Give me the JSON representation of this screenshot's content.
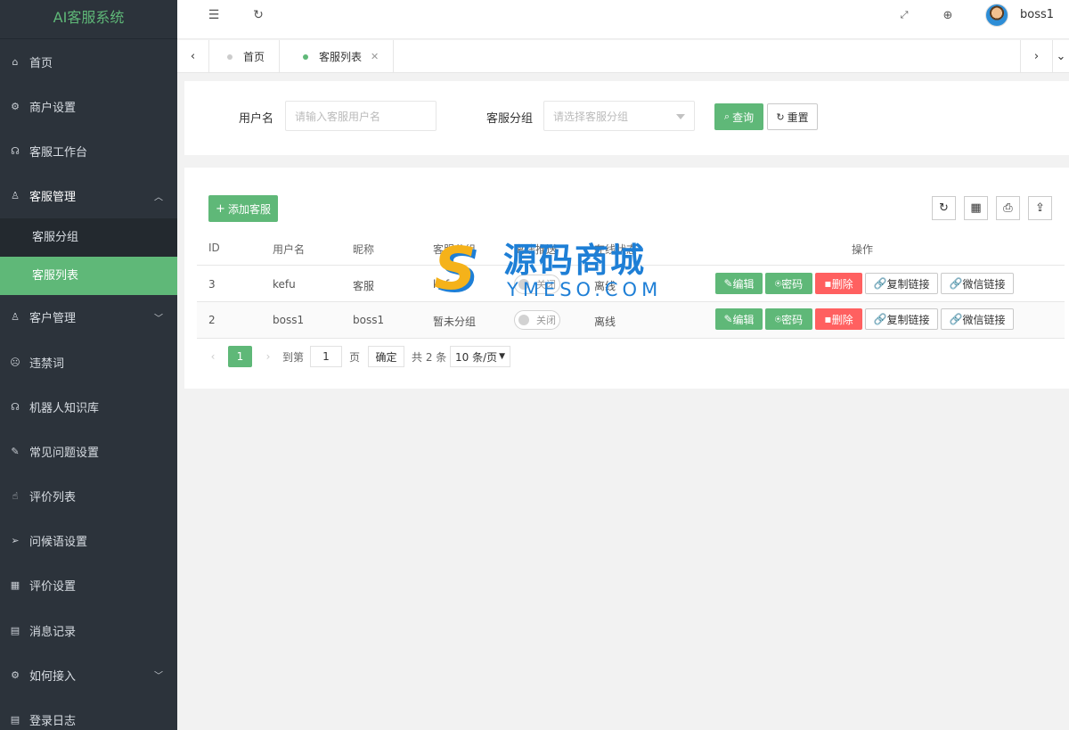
{
  "sidebar": {
    "logo": "AI客服系统",
    "items": [
      {
        "label": "首页",
        "icon": "home-icon",
        "glyph": "⌂"
      },
      {
        "label": "商户设置",
        "icon": "gear-icon",
        "glyph": "⚙"
      },
      {
        "label": "客服工作台",
        "icon": "headset-icon",
        "glyph": "☊"
      },
      {
        "label": "客服管理",
        "icon": "user-icon",
        "glyph": "♙"
      },
      {
        "label": "客户管理",
        "icon": "users-icon",
        "glyph": "♙"
      },
      {
        "label": "违禁词",
        "icon": "frown-icon",
        "glyph": "☹"
      },
      {
        "label": "机器人知识库",
        "icon": "headset-icon",
        "glyph": "☊"
      },
      {
        "label": "常见问题设置",
        "icon": "edit-icon",
        "glyph": "✎"
      },
      {
        "label": "评价列表",
        "icon": "thumbs-up-icon",
        "glyph": "☝"
      },
      {
        "label": "问候语设置",
        "icon": "send-icon",
        "glyph": "➢"
      },
      {
        "label": "评价设置",
        "icon": "calendar-icon",
        "glyph": "▦"
      },
      {
        "label": "消息记录",
        "icon": "document-icon",
        "glyph": "▤"
      },
      {
        "label": "如何接入",
        "icon": "gear-icon",
        "glyph": "⚙"
      },
      {
        "label": "登录日志",
        "icon": "log-icon",
        "glyph": "▤"
      }
    ],
    "submenu": [
      {
        "label": "客服分组"
      },
      {
        "label": "客服列表"
      }
    ]
  },
  "header": {
    "username": "boss1"
  },
  "tabs": [
    {
      "label": "首页"
    },
    {
      "label": "客服列表"
    }
  ],
  "search": {
    "username_label": "用户名",
    "username_placeholder": "请输入客服用户名",
    "group_label": "客服分组",
    "group_placeholder": "请选择客服分组",
    "query_label": "查询",
    "reset_label": "重置"
  },
  "toolbar": {
    "add_label": "添加客服"
  },
  "table": {
    "columns": [
      "ID",
      "用户名",
      "昵称",
      "客服分组",
      "离线推送",
      "在线状态",
      "操作"
    ],
    "rows": [
      {
        "id": "3",
        "username": "kefu",
        "nickname": "客服",
        "group": "kefu1",
        "push": "关闭",
        "status": "离线"
      },
      {
        "id": "2",
        "username": "boss1",
        "nickname": "boss1",
        "group": "暂未分组",
        "push": "关闭",
        "status": "离线"
      }
    ],
    "actions": {
      "edit": "编辑",
      "password": "密码",
      "delete": "删除",
      "copy_link": "复制链接",
      "wechat_link": "微信链接"
    }
  },
  "pagination": {
    "current_page": "1",
    "goto_prefix": "到第",
    "goto_value": "1",
    "goto_suffix": "页",
    "confirm": "确定",
    "total": "共 2 条",
    "per_page": "10 条/页"
  },
  "watermark": {
    "logo_letter": "S",
    "chinese": "源码商城",
    "english": "YMESO.COM"
  },
  "colors": {
    "accent": "#5fb878",
    "sidebar_bg": "#2c333b",
    "danger": "#ff6060"
  }
}
